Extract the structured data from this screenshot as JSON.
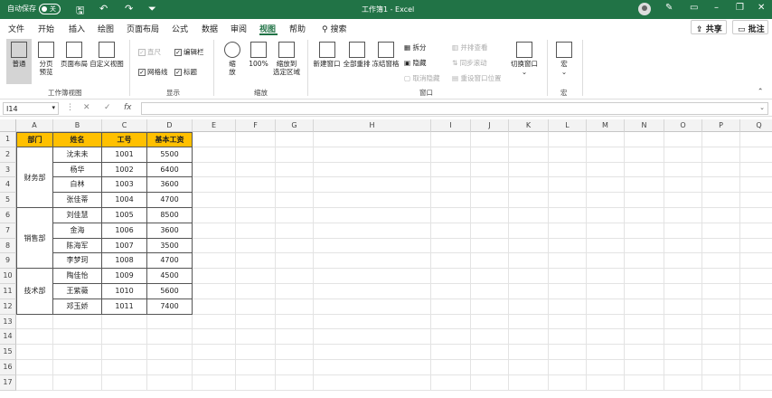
{
  "titlebar": {
    "autosave": "自动保存",
    "toggle": "关",
    "doc_title": "工作簿1 - Excel"
  },
  "menu": {
    "tabs": [
      "文件",
      "开始",
      "插入",
      "绘图",
      "页面布局",
      "公式",
      "数据",
      "审阅",
      "视图",
      "帮助"
    ],
    "active": "视图",
    "search": "搜索",
    "share": "共享",
    "comment": "批注"
  },
  "ribbon": {
    "workbook_views": {
      "group": "工作簿视图",
      "normal": "普通",
      "page_break": "分页\n预览",
      "page_layout": "页面布局",
      "custom": "自定义视图"
    },
    "show": {
      "group": "显示",
      "ruler": "直尺",
      "formula_bar": "编辑栏",
      "gridlines": "网格线",
      "headings": "标题"
    },
    "zoom": {
      "group": "缩放",
      "zoom": "缩\n放",
      "zoom100": "100%",
      "zoom_sel": "缩放到\n选定区域"
    },
    "window": {
      "group": "窗口",
      "new_window": "新建窗口",
      "arrange": "全部重排",
      "freeze": "冻结窗格",
      "split": "拆分",
      "hide": "隐藏",
      "unhide": "取消隐藏",
      "side": "并排查看",
      "sync": "同步滚动",
      "reset": "重设窗口位置",
      "switch": "切换窗口"
    },
    "macro": {
      "group": "宏",
      "macro": "宏"
    }
  },
  "formula_bar": {
    "name_box": "I14",
    "fx": "fx"
  },
  "columns": [
    "A",
    "B",
    "C",
    "D",
    "E",
    "F",
    "G",
    "H",
    "I",
    "J",
    "K",
    "L",
    "M",
    "N",
    "O",
    "P",
    "Q"
  ],
  "rows": [
    "1",
    "2",
    "3",
    "4",
    "5",
    "6",
    "7",
    "8",
    "9",
    "10",
    "11",
    "12",
    "13",
    "14",
    "15",
    "16",
    "17"
  ],
  "table": {
    "headers": [
      "部门",
      "姓名",
      "工号",
      "基本工资"
    ],
    "departments": [
      {
        "name": "财务部",
        "span": 4
      },
      {
        "name": "销售部",
        "span": 4
      },
      {
        "name": "技术部",
        "span": 3
      }
    ],
    "names": [
      "沈未未",
      "杨华",
      "白林",
      "张佳蒂",
      "刘佳慧",
      "金海",
      "陈海军",
      "李梦珂",
      "陶佳怡",
      "王紫薇",
      "邓玉娇"
    ],
    "ids": [
      "1001",
      "1002",
      "1003",
      "1004",
      "1005",
      "1006",
      "1007",
      "1008",
      "1009",
      "1010",
      "1011"
    ],
    "salaries": [
      "5500",
      "6400",
      "3600",
      "4700",
      "8500",
      "3600",
      "3500",
      "4700",
      "4500",
      "5600",
      "7400"
    ]
  },
  "colors": {
    "excel_green": "#217346",
    "header_fill": "#ffc000"
  }
}
